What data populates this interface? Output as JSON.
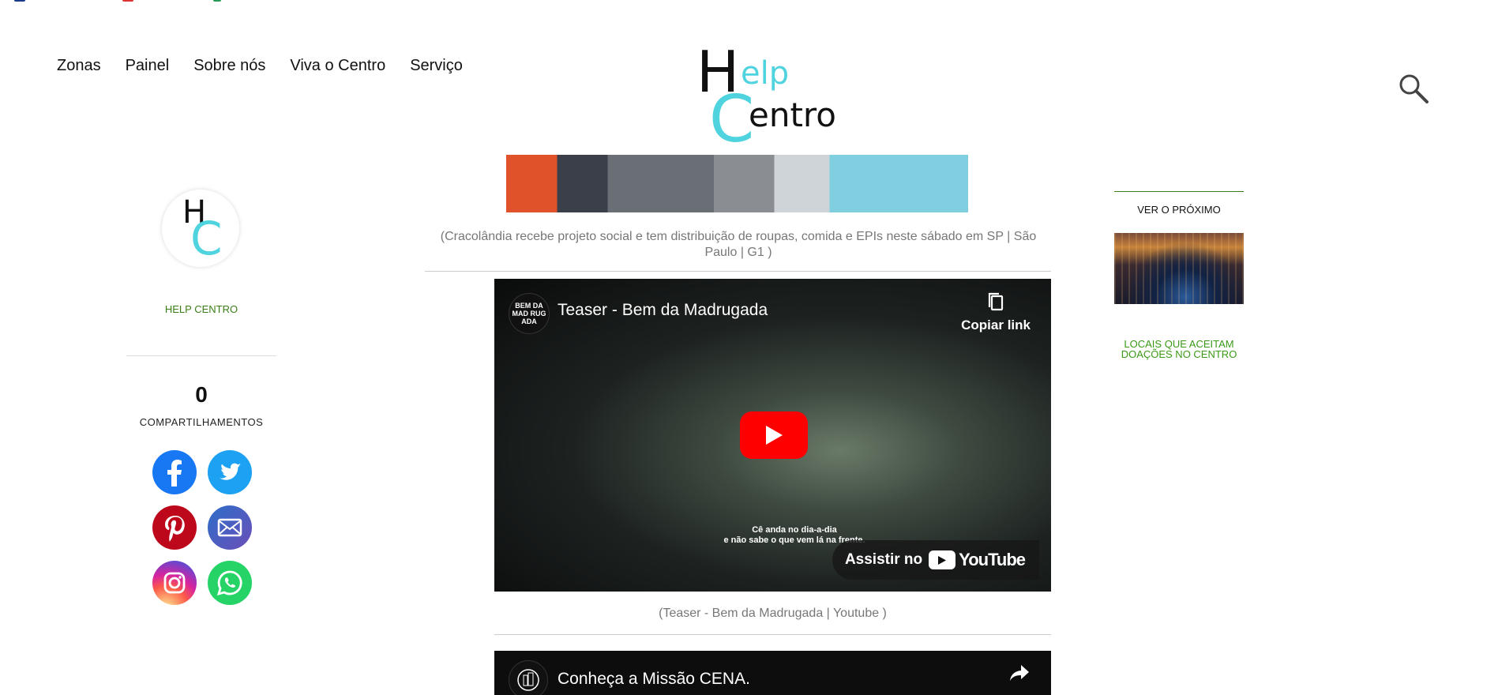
{
  "nav": {
    "items": [
      "Zonas",
      "Painel",
      "Sobre nós",
      "Viva o Centro",
      "Serviço"
    ]
  },
  "logo": {
    "h": "H",
    "elp": "elp",
    "c": "C",
    "entro": "entro"
  },
  "sidebar_left": {
    "site_name": "HELP CENTRO",
    "share_count": "0",
    "share_label": "COMPARTILHAMENTOS",
    "social": [
      "facebook",
      "twitter",
      "pinterest",
      "email",
      "instagram",
      "whatsapp"
    ]
  },
  "content": {
    "image_caption": "(Cracolândia recebe projeto social e tem distribuição de roupas, comida e EPIs neste sábado em SP | São Paulo | G1 )",
    "video1": {
      "channel": "BEM DA MAD RUG ADA",
      "title": "Teaser - Bem da Madrugada",
      "copy_label": "Copiar link",
      "subtitle_line1": "Cê anda no dia-a-dia",
      "subtitle_line2": "e não sabe o que vem lá na frente.",
      "watch_label": "Assistir no",
      "youtube": "YouTube"
    },
    "video1_caption": "(Teaser - Bem da Madrugada | Youtube )",
    "video2": {
      "title": "Conheça a Missão CENA.",
      "share_label": "Compartilh..."
    }
  },
  "sidebar_right": {
    "next_label": "VER O PRÓXIMO",
    "link_line1": "LOCAIS QUE ACEITAM",
    "link_line2": "DOAÇÕES NO CENTRO"
  },
  "colors": {
    "accent_green": "#3a7d17",
    "logo_cyan": "#4fd3de",
    "youtube_red": "#ff0000"
  }
}
